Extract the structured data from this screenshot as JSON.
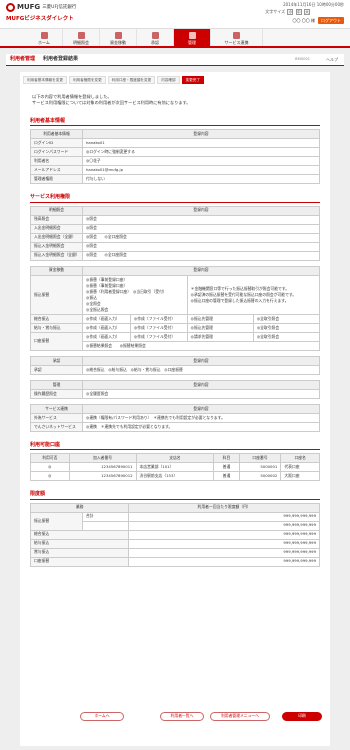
{
  "header": {
    "bank_name": "三菱UFJ信託銀行",
    "brand": "MUFG",
    "service": "MUFGビジネスダイレクト",
    "datetime": "2014年11月16日 10時00分00秒",
    "font_size_label": "文字サイズ",
    "font_sizes": [
      "小",
      "中",
      "大"
    ],
    "user": "〇〇 〇〇 様",
    "logout": "ログアウト"
  },
  "nav": {
    "items": [
      "ホーム",
      "明細照会",
      "資金移動",
      "承認",
      "管理",
      "サービス連携"
    ]
  },
  "titlebar": {
    "title1": "利用者管理",
    "title2": "利用者登録結果",
    "screen_code": "BMG001",
    "help": "ヘルプ"
  },
  "steps": [
    "利用者基本情報を変更",
    "利用者権限を変更",
    "利用口座・限度額を変更",
    "内容確認",
    "変更完了"
  ],
  "message": {
    "line1": "以下の内容で利用者情報を登録しました。",
    "line2": "サービス利用権限については対象の利用者が次回サービス利用時に有効になります。"
  },
  "basic": {
    "heading": "利用者基本情報",
    "col_key": "利用者基本情報",
    "col_val": "登録内容",
    "rows": [
      {
        "k": "ログインID",
        "v": "hanako01"
      },
      {
        "k": "ログインパスワード",
        "v": "◎ログイン時に強制変更する"
      },
      {
        "k": "利用者名",
        "v": "◎〇花子"
      },
      {
        "k": "メールアドレス",
        "v": "hanako01@mufg.jp"
      },
      {
        "k": "管理者権限",
        "v": "付与しない"
      }
    ]
  },
  "service": {
    "heading": "サービス利用権限",
    "t1": {
      "col_key": "明細照会",
      "col_val": "登録内容",
      "rows": [
        {
          "k": "残高照会",
          "v": "◎照会"
        },
        {
          "k": "入出金明細照会",
          "v": "◎照会"
        },
        {
          "k": "入出金明細照会（全銀）",
          "v": "◎照会　　◎全口座照会"
        },
        {
          "k": "振込入金明細照会",
          "v": "◎照会"
        },
        {
          "k": "振込入金明細照会（全銀）",
          "v": "◎照会　　◎全口座照会"
        }
      ]
    },
    "t2": {
      "col_key": "資金移動",
      "col_val": "登録内容",
      "furikomi_label": "振込振替",
      "furikomi_lines": [
        "◎振替（事前登録口座）",
        "◎振替（事前登録口座）",
        "◎振替（利用者登録口座）　◎当日取引（受付）",
        "◎振込",
        "◎全照会",
        "◎全振込照会"
      ],
      "furikomi_notes": [
        "＊金融機関窓口等で行った振込振替取引が照会可能です。",
        "◎承認済の振込振替を受付可能な振込口座の照会が可能です。",
        "◎振込口座の管理で登録した振込振替の入力を行えます。"
      ],
      "rows": [
        {
          "k": "総合振込",
          "v": [
            "◎作成（画面入力）",
            "◎作成（ファイル受付）",
            "◎振込先管理",
            "◎全取引照会"
          ]
        },
        {
          "k": "給与・賞与振込",
          "v": [
            "◎作成（画面入力）",
            "◎作成（ファイル受付）",
            "◎振込先管理",
            "◎全取引照会"
          ]
        },
        {
          "k": "口座振替",
          "v": [
            "◎作成（画面入力）",
            "◎作成（ファイル受付）",
            "◎請求先管理",
            "◎全取引照会"
          ]
        }
      ],
      "koza_extra": "◎振替結果照会　　◎振替結果照会"
    },
    "t3": {
      "col_key": "承認",
      "col_val": "登録内容",
      "rows": [
        {
          "k": "承認",
          "v": "◎総合振込　◎給与振込　◎給与・賞与振込　◎口座振替"
        }
      ]
    },
    "t4": {
      "col_key": "管理",
      "col_val": "登録内容",
      "rows": [
        {
          "k": "操作履歴照会",
          "v": "◎全履歴照会"
        }
      ]
    },
    "t5": {
      "col_key": "サービス連携",
      "col_val": "登録内容",
      "rows": [
        {
          "k": "外為サービス",
          "v": "◎連携（権限有/パスワード利用あり）　＊連携先でも利用設定が必要となります。"
        },
        {
          "k": "でんさいネットサービス",
          "v": "◎連携　＊連携先でも利用設定が必要となります。"
        }
      ]
    }
  },
  "accounts": {
    "heading": "利用可能口座",
    "cols": [
      "利用可否",
      "加入者番号",
      "支店名",
      "科目",
      "口座番号",
      "口座名"
    ],
    "rows": [
      {
        "a": "◎",
        "b": "1234567890011",
        "c": "本店営業部（101）",
        "d": "普通",
        "e": "5000001",
        "f": "代表口座"
      },
      {
        "a": "◎",
        "b": "1234567890012",
        "c": "渋谷駅前支店（153）",
        "d": "普通",
        "e": "5000002",
        "f": "大阪口座"
      }
    ]
  },
  "limits": {
    "heading": "限度額",
    "col_key": "業務",
    "col_val": "利用者一回当たり限度額（円）",
    "rows": [
      {
        "k": "振込振替",
        "sub": "合計",
        "v": "999,999,999,999"
      },
      {
        "k": "",
        "sub": "",
        "v": "999,999,999,999"
      },
      {
        "k": "総合振込",
        "sub": "",
        "v": "999,999,999,999"
      },
      {
        "k": "給与振込",
        "sub": "",
        "v": "999,999,999,999"
      },
      {
        "k": "賞与振込",
        "sub": "",
        "v": "999,999,999,999"
      },
      {
        "k": "口座振替",
        "sub": "",
        "v": "999,999,999,999"
      }
    ]
  },
  "buttons": {
    "home": "ホームへ",
    "list": "利用者一覧へ",
    "menu": "利用者管理メニューへ",
    "print": "印刷"
  }
}
